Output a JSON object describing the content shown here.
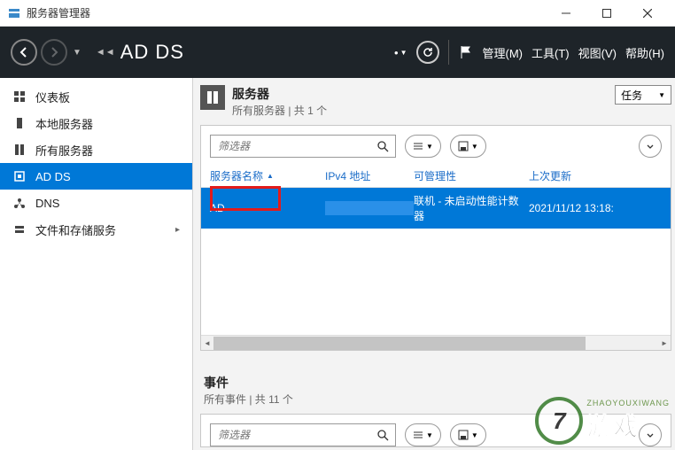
{
  "window": {
    "title": "服务器管理器"
  },
  "breadcrumb": {
    "current": "AD DS"
  },
  "nav_menu": {
    "manage": "管理(M)",
    "tools": "工具(T)",
    "view": "视图(V)",
    "help": "帮助(H)"
  },
  "sidebar": {
    "items": [
      {
        "icon": "dashboard-icon",
        "label": "仪表板"
      },
      {
        "icon": "server-icon",
        "label": "本地服务器"
      },
      {
        "icon": "servers-icon",
        "label": "所有服务器"
      },
      {
        "icon": "adds-icon",
        "label": "AD DS"
      },
      {
        "icon": "dns-icon",
        "label": "DNS"
      },
      {
        "icon": "storage-icon",
        "label": "文件和存储服务",
        "expandable": true
      }
    ],
    "active_index": 3
  },
  "servers_section": {
    "title": "服务器",
    "subtitle": "所有服务器 | 共 1 个",
    "task_label": "任务",
    "filter_placeholder": "筛选器",
    "columns": {
      "name": "服务器名称",
      "ipv4": "IPv4 地址",
      "manageability": "可管理性",
      "last_update": "上次更新"
    },
    "rows": [
      {
        "name": "AD",
        "ipv4": "",
        "manageability": "联机 - 未启动性能计数器",
        "last_update": "2021/11/12 13:18:"
      }
    ]
  },
  "events_section": {
    "title": "事件",
    "subtitle": "所有事件 | 共 11 个",
    "filter_placeholder": "筛选器"
  },
  "watermark": {
    "badge": "7",
    "text": "游戏",
    "domain": "ZHAOYOUXIWANG"
  }
}
